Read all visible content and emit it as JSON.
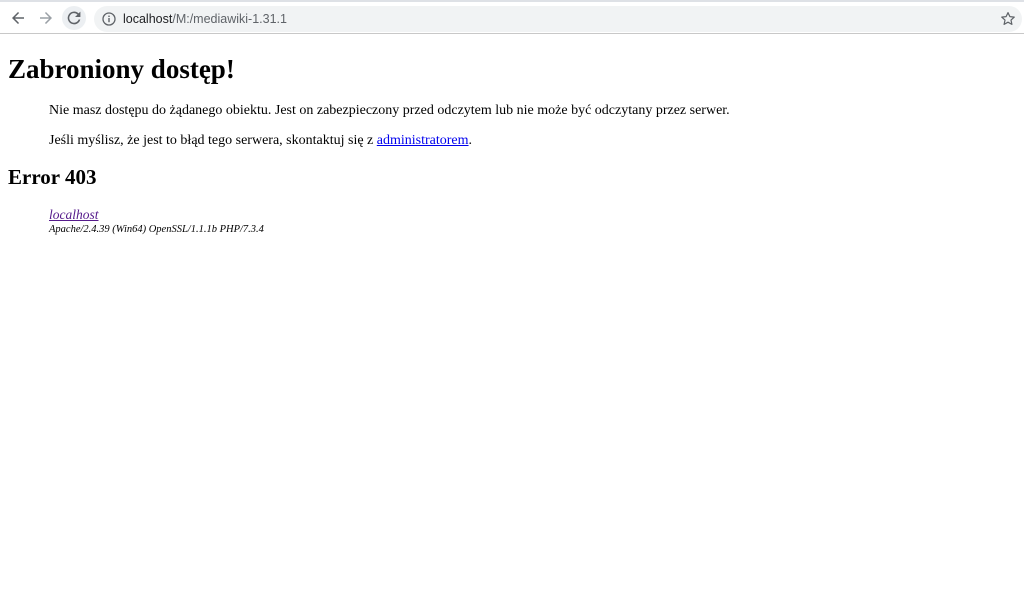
{
  "browser": {
    "url_host": "localhost",
    "url_path": "/M:/mediawiki-1.31.1",
    "icons": {
      "back": "arrow-left-icon",
      "forward": "arrow-right-icon",
      "reload": "reload-icon",
      "info": "info-icon",
      "bookmark": "star-icon"
    }
  },
  "page": {
    "title": "Zabroniony dostęp!",
    "paragraph1": "Nie masz dostępu do żądanego obiektu. Jest on zabezpieczony przed odczytem lub nie może być odczytany przez serwer.",
    "paragraph2_prefix": "Jeśli myślisz, że jest to błąd tego serwera, skontaktuj się z ",
    "paragraph2_link": "administratorem",
    "paragraph2_suffix": ".",
    "error_heading": "Error 403",
    "signature": {
      "host": "localhost",
      "server": "Apache/2.4.39 (Win64) OpenSSL/1.1.1b PHP/7.3.4"
    }
  },
  "colors": {
    "link": "#0000ee",
    "visited_link": "#551a8b",
    "omnibox_bg": "#f1f3f4"
  }
}
